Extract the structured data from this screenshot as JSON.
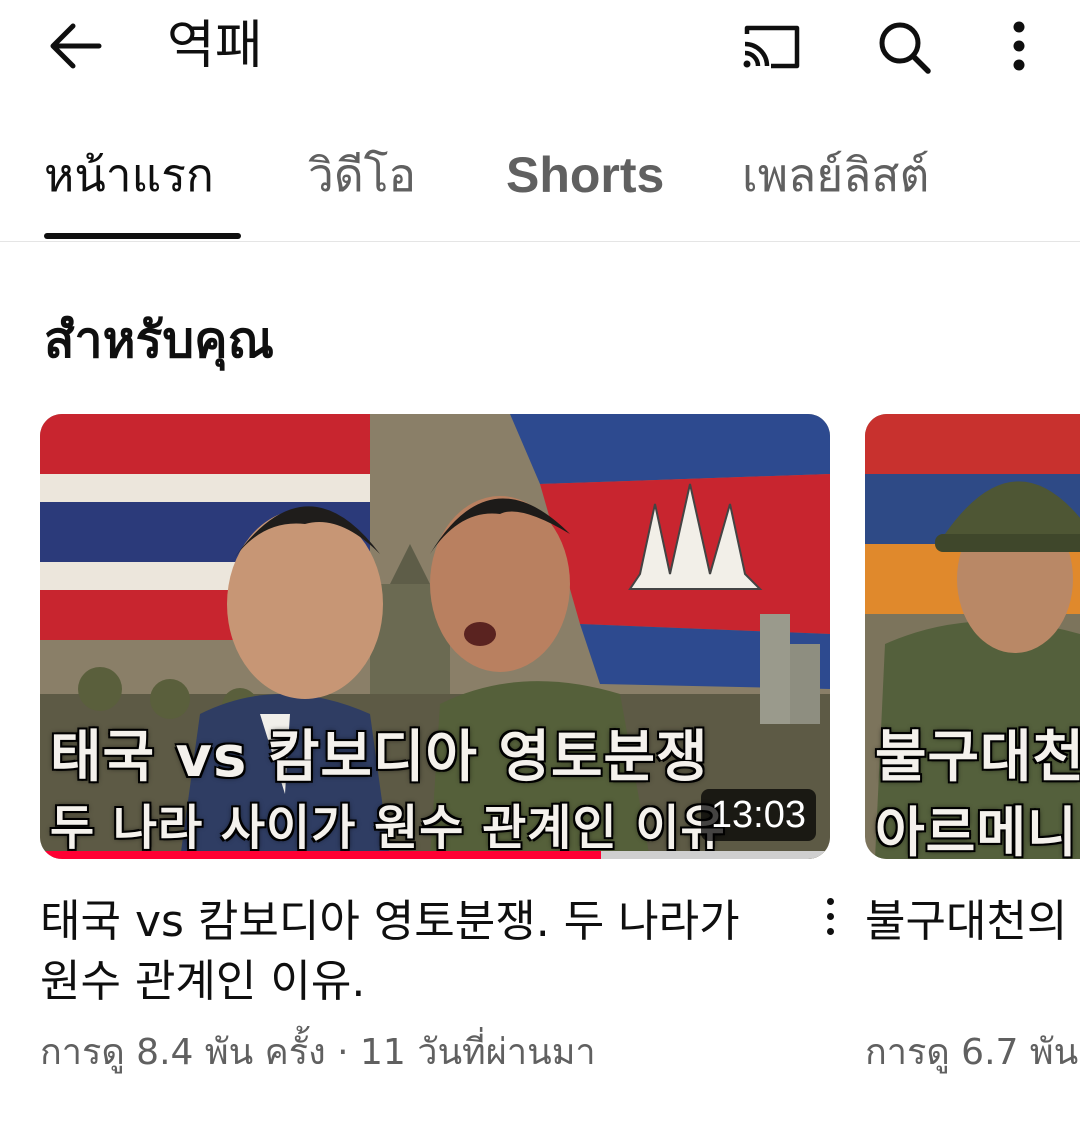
{
  "header": {
    "channel_title": "역패",
    "icons": [
      "arrow-left-icon",
      "cast-icon",
      "search-icon",
      "more-vertical-icon"
    ]
  },
  "tabs": [
    {
      "label": "หน้าแรก",
      "active": true
    },
    {
      "label": "วิดีโอ",
      "active": false
    },
    {
      "label": "Shorts",
      "active": false
    },
    {
      "label": "เพลย์ลิสต์",
      "active": false
    }
  ],
  "section": {
    "title": "สำหรับคุณ"
  },
  "videos": [
    {
      "title": "태국 vs 캄보디아 영토분쟁. 두 나라가 원수 관계인 이유.",
      "meta": "การดู 8.4 พัน ครั้ง · 11 วันที่ผ่านมา",
      "duration": "13:03",
      "watched_fraction": 0.71,
      "thumb_line1": "태국 vs 캄보디아 영토분쟁",
      "thumb_line2": "두 나라 사이가 원수 관계인 이유"
    },
    {
      "title": "불구대천의 아제르바이잔",
      "meta": "การดู 6.7 พัน",
      "thumb_line1": "불구대천",
      "thumb_line2": "아르메니"
    }
  ],
  "colors": {
    "progress": "#ff0033",
    "text_primary": "#0f0f0f",
    "text_secondary": "#606060"
  }
}
